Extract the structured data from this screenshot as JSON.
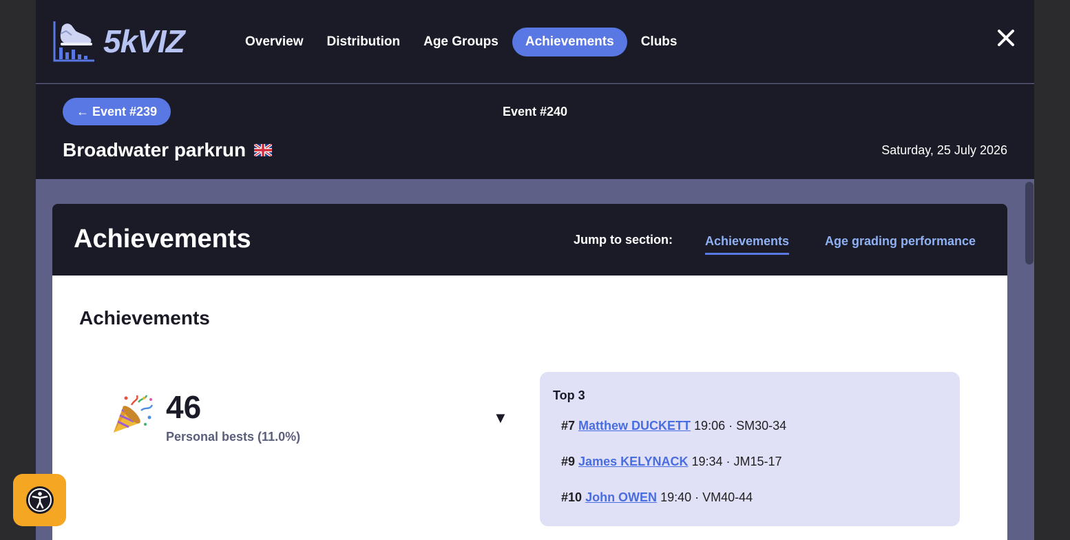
{
  "brand": {
    "name": "5kVIZ"
  },
  "nav": {
    "items": [
      {
        "label": "Overview",
        "active": false
      },
      {
        "label": "Distribution",
        "active": false
      },
      {
        "label": "Age Groups",
        "active": false
      },
      {
        "label": "Achievements",
        "active": true
      },
      {
        "label": "Clubs",
        "active": false
      }
    ],
    "close_icon": "close-icon"
  },
  "event": {
    "prev_label": "← Event #239",
    "current_label": "Event #240",
    "name": "Broadwater parkrun",
    "flag_icon": "uk-flag-icon",
    "date": "Saturday, 25 July 2026"
  },
  "card": {
    "title": "Achievements",
    "jump_label": "Jump to section:",
    "jump_links": [
      "Achievements",
      "Age grading performance"
    ]
  },
  "section": {
    "title": "Achievements",
    "stat": {
      "icon": "party-popper-icon",
      "value": "46",
      "label": "Personal bests (11.0%)",
      "toggle": "▼"
    },
    "top3": {
      "title": "Top 3",
      "rows": [
        {
          "rank": "#7",
          "name": "Matthew DUCKETT",
          "detail": " 19:06 · SM30-34"
        },
        {
          "rank": "#9",
          "name": "James KELYNACK",
          "detail": " 19:34 · JM15-17"
        },
        {
          "rank": "#10",
          "name": "John OWEN",
          "detail": " 19:40 · VM40-44"
        }
      ]
    }
  },
  "colors": {
    "accent": "#5a78e3",
    "dark": "#1a1b27",
    "panel": "#e0e1f7",
    "a11y": "#f5a623"
  }
}
